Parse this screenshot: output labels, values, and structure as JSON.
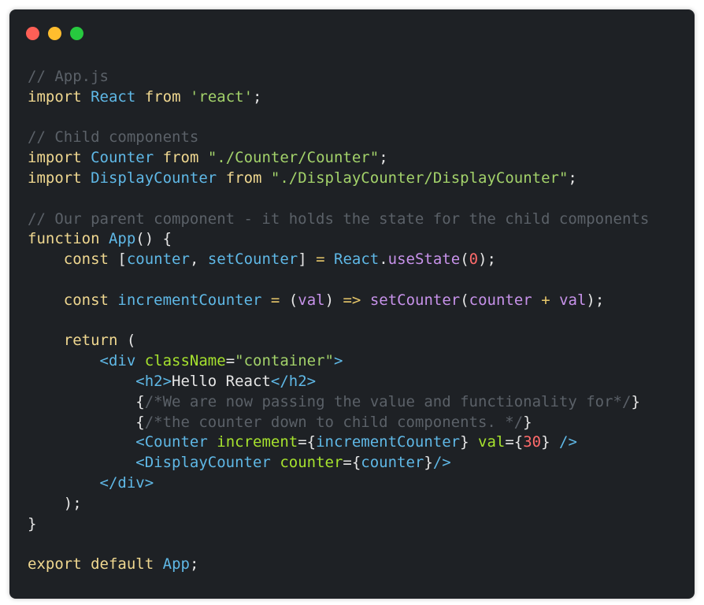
{
  "window": {
    "buttons": [
      {
        "name": "close",
        "color": "#ff5f56"
      },
      {
        "name": "minimize",
        "color": "#ffbd2e"
      },
      {
        "name": "maximize",
        "color": "#27c93f"
      }
    ]
  },
  "code": {
    "lines": [
      [
        {
          "t": "// App.js",
          "c": "cm"
        }
      ],
      [
        {
          "t": "import",
          "c": "kw"
        },
        {
          "t": " ",
          "c": "pu"
        },
        {
          "t": "React",
          "c": "id"
        },
        {
          "t": " ",
          "c": "pu"
        },
        {
          "t": "from",
          "c": "kw"
        },
        {
          "t": " ",
          "c": "pu"
        },
        {
          "t": "'react'",
          "c": "str"
        },
        {
          "t": ";",
          "c": "pu"
        }
      ],
      [],
      [
        {
          "t": "// Child components",
          "c": "cm"
        }
      ],
      [
        {
          "t": "import",
          "c": "kw"
        },
        {
          "t": " ",
          "c": "pu"
        },
        {
          "t": "Counter",
          "c": "id"
        },
        {
          "t": " ",
          "c": "pu"
        },
        {
          "t": "from",
          "c": "kw"
        },
        {
          "t": " ",
          "c": "pu"
        },
        {
          "t": "\"./Counter/Counter\"",
          "c": "str"
        },
        {
          "t": ";",
          "c": "pu"
        }
      ],
      [
        {
          "t": "import",
          "c": "kw"
        },
        {
          "t": " ",
          "c": "pu"
        },
        {
          "t": "DisplayCounter",
          "c": "id"
        },
        {
          "t": " ",
          "c": "pu"
        },
        {
          "t": "from",
          "c": "kw"
        },
        {
          "t": " ",
          "c": "pu"
        },
        {
          "t": "\"./DisplayCounter/DisplayCounter\"",
          "c": "str"
        },
        {
          "t": ";",
          "c": "pu"
        }
      ],
      [],
      [
        {
          "t": "// Our parent component - it holds the state for the child components",
          "c": "cm"
        }
      ],
      [
        {
          "t": "function",
          "c": "kw"
        },
        {
          "t": " ",
          "c": "pu"
        },
        {
          "t": "App",
          "c": "fn"
        },
        {
          "t": "() {",
          "c": "pu"
        }
      ],
      [
        {
          "t": "    ",
          "c": "pu"
        },
        {
          "t": "const",
          "c": "kw"
        },
        {
          "t": " [",
          "c": "pu"
        },
        {
          "t": "counter",
          "c": "id"
        },
        {
          "t": ", ",
          "c": "pu"
        },
        {
          "t": "setCounter",
          "c": "id"
        },
        {
          "t": "] ",
          "c": "pu"
        },
        {
          "t": "=",
          "c": "op"
        },
        {
          "t": " ",
          "c": "pu"
        },
        {
          "t": "React",
          "c": "id"
        },
        {
          "t": ".",
          "c": "pu"
        },
        {
          "t": "useState",
          "c": "mth"
        },
        {
          "t": "(",
          "c": "pu"
        },
        {
          "t": "0",
          "c": "num"
        },
        {
          "t": ");",
          "c": "pu"
        }
      ],
      [],
      [
        {
          "t": "    ",
          "c": "pu"
        },
        {
          "t": "const",
          "c": "kw"
        },
        {
          "t": " ",
          "c": "pu"
        },
        {
          "t": "incrementCounter",
          "c": "id"
        },
        {
          "t": " ",
          "c": "pu"
        },
        {
          "t": "=",
          "c": "op"
        },
        {
          "t": " (",
          "c": "pu"
        },
        {
          "t": "val",
          "c": "mth"
        },
        {
          "t": ") ",
          "c": "pu"
        },
        {
          "t": "=>",
          "c": "op"
        },
        {
          "t": " ",
          "c": "pu"
        },
        {
          "t": "setCounter",
          "c": "mth"
        },
        {
          "t": "(",
          "c": "pu"
        },
        {
          "t": "counter",
          "c": "mth"
        },
        {
          "t": " ",
          "c": "pu"
        },
        {
          "t": "+",
          "c": "op"
        },
        {
          "t": " ",
          "c": "pu"
        },
        {
          "t": "val",
          "c": "mth"
        },
        {
          "t": ");",
          "c": "pu"
        }
      ],
      [],
      [
        {
          "t": "    ",
          "c": "pu"
        },
        {
          "t": "return",
          "c": "kw"
        },
        {
          "t": " (",
          "c": "pu"
        }
      ],
      [
        {
          "t": "        ",
          "c": "pu"
        },
        {
          "t": "<div",
          "c": "tag"
        },
        {
          "t": " ",
          "c": "pu"
        },
        {
          "t": "className",
          "c": "attr"
        },
        {
          "t": "=",
          "c": "pu"
        },
        {
          "t": "\"container\"",
          "c": "str"
        },
        {
          "t": ">",
          "c": "tag"
        }
      ],
      [
        {
          "t": "            ",
          "c": "pu"
        },
        {
          "t": "<h2>",
          "c": "tag"
        },
        {
          "t": "Hello React",
          "c": "txt"
        },
        {
          "t": "</h2>",
          "c": "tag"
        }
      ],
      [
        {
          "t": "            ",
          "c": "pu"
        },
        {
          "t": "{",
          "c": "pu"
        },
        {
          "t": "/*We are now passing the value and functionality for*/",
          "c": "cm"
        },
        {
          "t": "}",
          "c": "pu"
        }
      ],
      [
        {
          "t": "            ",
          "c": "pu"
        },
        {
          "t": "{",
          "c": "pu"
        },
        {
          "t": "/*the counter down to child components. */",
          "c": "cm"
        },
        {
          "t": "}",
          "c": "pu"
        }
      ],
      [
        {
          "t": "            ",
          "c": "pu"
        },
        {
          "t": "<Counter",
          "c": "tag"
        },
        {
          "t": " ",
          "c": "pu"
        },
        {
          "t": "increment",
          "c": "attr"
        },
        {
          "t": "={",
          "c": "pu"
        },
        {
          "t": "incrementCounter",
          "c": "id"
        },
        {
          "t": "} ",
          "c": "pu"
        },
        {
          "t": "val",
          "c": "attr"
        },
        {
          "t": "={",
          "c": "pu"
        },
        {
          "t": "30",
          "c": "num"
        },
        {
          "t": "} ",
          "c": "pu"
        },
        {
          "t": "/>",
          "c": "tag"
        }
      ],
      [
        {
          "t": "            ",
          "c": "pu"
        },
        {
          "t": "<DisplayCounter",
          "c": "tag"
        },
        {
          "t": " ",
          "c": "pu"
        },
        {
          "t": "counter",
          "c": "attr"
        },
        {
          "t": "={",
          "c": "pu"
        },
        {
          "t": "counter",
          "c": "id"
        },
        {
          "t": "}",
          "c": "pu"
        },
        {
          "t": "/>",
          "c": "tag"
        }
      ],
      [
        {
          "t": "        ",
          "c": "pu"
        },
        {
          "t": "</div>",
          "c": "tag"
        }
      ],
      [
        {
          "t": "    );",
          "c": "pu"
        }
      ],
      [
        {
          "t": "}",
          "c": "pu"
        }
      ],
      [],
      [
        {
          "t": "export",
          "c": "kw"
        },
        {
          "t": " ",
          "c": "pu"
        },
        {
          "t": "default",
          "c": "kw"
        },
        {
          "t": " ",
          "c": "pu"
        },
        {
          "t": "App",
          "c": "id"
        },
        {
          "t": ";",
          "c": "pu"
        }
      ]
    ]
  }
}
